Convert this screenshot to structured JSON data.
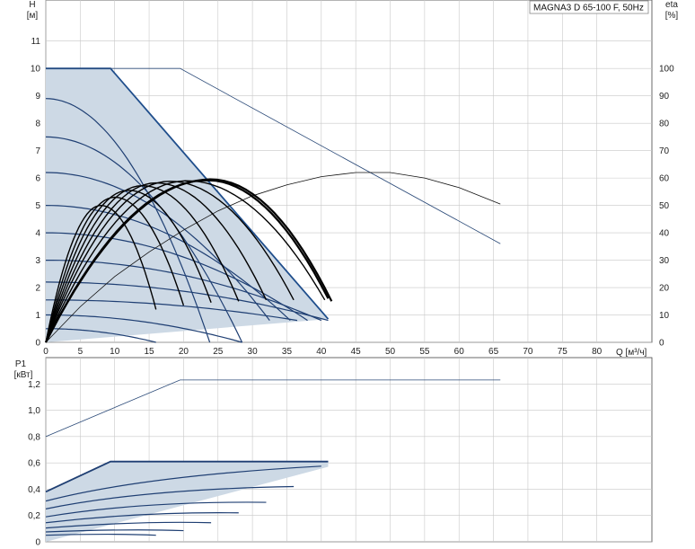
{
  "title": "MAGNA3 D 65-100 F, 50Hz",
  "colors": {
    "grid": "#c8c8c8",
    "axis": "#444444",
    "region_fill": "#cdd9e5",
    "region_edge": "#1f4e8c",
    "curve_blue": "#1f3f73",
    "curve_black": "#000000",
    "thin": "#2b4a78"
  },
  "chart_data": [
    {
      "type": "line",
      "name": "head",
      "ylabel_top": "H",
      "ylabel_unit": "[м]",
      "y2label_top": "eta",
      "y2label_unit": "[%]",
      "xlabel": "Q [м³/ч]",
      "xlim": [
        0,
        88
      ],
      "ylim": [
        0,
        12.5
      ],
      "y2lim": [
        0,
        125
      ],
      "x_ticks": [
        0,
        5,
        10,
        15,
        20,
        25,
        30,
        35,
        40,
        45,
        50,
        55,
        60,
        65,
        70,
        75,
        80
      ],
      "y_ticks": [
        0,
        1,
        2,
        3,
        4,
        5,
        6,
        7,
        8,
        9,
        10,
        11
      ],
      "y2_ticks": [
        0,
        10,
        20,
        30,
        40,
        50,
        60,
        70,
        80,
        90,
        100
      ],
      "grid": true,
      "region": {
        "x": [
          0,
          9.4,
          41
        ],
        "y": [
          10,
          10,
          0.85
        ],
        "bottom_x": [
          0,
          41
        ],
        "bottom_y": [
          0,
          0.85
        ]
      },
      "max_head_line": {
        "x": [
          0,
          19.5,
          66
        ],
        "y": [
          10,
          10,
          3.6
        ]
      },
      "eta_curve": {
        "x": [
          0,
          5,
          10,
          15,
          20,
          25,
          30,
          35,
          40,
          45,
          50,
          55,
          60,
          66
        ],
        "eta": [
          0,
          13,
          24,
          33,
          41,
          48,
          53.5,
          57.5,
          60.5,
          62,
          62,
          60,
          56.5,
          50.5
        ]
      },
      "blue_curves": [
        {
          "h0": 8.9,
          "qmax": 23.8
        },
        {
          "h0": 7.5,
          "qmax": 28.5
        },
        {
          "h0": 6.2,
          "qmax": 32.5
        },
        {
          "h0": 5.0,
          "qmax": 35.5
        },
        {
          "h0": 4.0,
          "qmax": 38.0
        },
        {
          "h0": 3.0,
          "qmax": 40.0
        },
        {
          "h0": 2.2,
          "qmax": 41.0
        },
        {
          "h0": 1.55,
          "qmax": 36.5
        },
        {
          "h0": 1.0,
          "qmax": 28.5
        },
        {
          "h0": 0.5,
          "qmax": 16.0
        }
      ],
      "black_curves": [
        {
          "q_peak": 8.0,
          "h_peak": 5.0,
          "q_end": 16.0,
          "h_end": 1.2
        },
        {
          "q_peak": 10.0,
          "h_peak": 5.3,
          "q_end": 20.0,
          "h_end": 1.35
        },
        {
          "q_peak": 12.0,
          "h_peak": 5.55,
          "q_end": 24.0,
          "h_end": 1.45
        },
        {
          "q_peak": 14.0,
          "h_peak": 5.72,
          "q_end": 28.0,
          "h_end": 1.5
        },
        {
          "q_peak": 16.0,
          "h_peak": 5.82,
          "q_end": 32.0,
          "h_end": 1.55
        },
        {
          "q_peak": 18.0,
          "h_peak": 5.88,
          "q_end": 36.0,
          "h_end": 1.55
        },
        {
          "q_peak": 20.5,
          "h_peak": 5.9,
          "q_end": 40.5,
          "h_end": 1.55
        },
        {
          "q_peak": 23.5,
          "h_peak": 5.92,
          "q_end": 41.0,
          "h_end": 1.6,
          "bold": true
        },
        {
          "q_peak": 24.0,
          "h_peak": 5.95,
          "q_end": 41.5,
          "h_end": 1.5,
          "bold": true
        }
      ]
    },
    {
      "type": "line",
      "name": "power",
      "ylabel_top": "P1",
      "ylabel_unit": "[кВт]",
      "xlim": [
        0,
        88
      ],
      "ylim": [
        0,
        1.4
      ],
      "y_ticks": [
        0,
        0.2,
        0.4,
        0.6,
        0.8,
        1.0,
        1.2
      ],
      "y_tick_labels": [
        "0",
        "0,2",
        "0,4",
        "0,6",
        "0,8",
        "1,0",
        "1,2"
      ],
      "x_ticks": [
        0,
        5,
        10,
        15,
        20,
        25,
        30,
        35,
        40,
        45,
        50,
        55,
        60,
        65,
        70,
        75,
        80
      ],
      "grid": true,
      "max_power_line": {
        "x": [
          0,
          19.5,
          66
        ],
        "y": [
          0.8,
          1.23,
          1.23
        ]
      },
      "region": {
        "x": [
          0,
          9.4,
          41,
          41,
          0
        ],
        "y": [
          0.38,
          0.61,
          0.61,
          0.57,
          0.0
        ]
      },
      "blue_curves": [
        {
          "q": [
            0,
            9.4,
            41
          ],
          "p": [
            0.38,
            0.61,
            0.61
          ]
        },
        {
          "q": [
            0,
            14,
            40
          ],
          "p": [
            0.31,
            0.5,
            0.575
          ]
        },
        {
          "q": [
            0,
            14,
            36
          ],
          "p": [
            0.25,
            0.4,
            0.42
          ]
        },
        {
          "q": [
            0,
            14,
            32
          ],
          "p": [
            0.19,
            0.31,
            0.3
          ]
        },
        {
          "q": [
            0,
            14,
            28
          ],
          "p": [
            0.145,
            0.23,
            0.22
          ]
        },
        {
          "q": [
            0,
            14,
            24
          ],
          "p": [
            0.105,
            0.16,
            0.145
          ]
        },
        {
          "q": [
            0,
            12,
            20
          ],
          "p": [
            0.075,
            0.1,
            0.085
          ]
        },
        {
          "q": [
            0,
            10,
            16
          ],
          "p": [
            0.05,
            0.065,
            0.05
          ]
        }
      ]
    }
  ]
}
